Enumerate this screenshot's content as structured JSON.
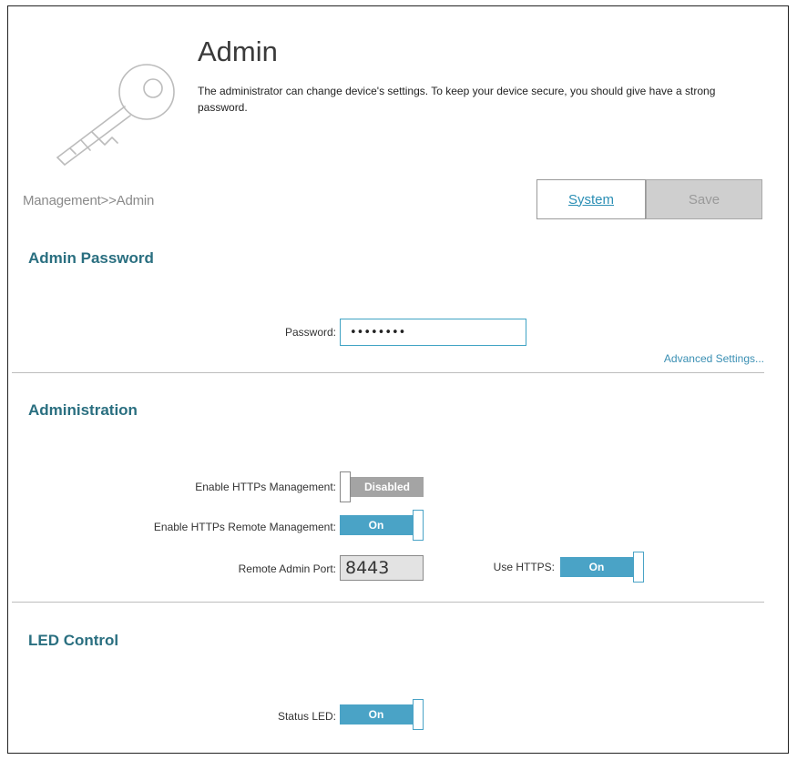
{
  "header": {
    "title": "Admin",
    "description": "The administrator can change device's settings. To keep your device secure, you should give have a strong password."
  },
  "breadcrumb": "Management>>Admin",
  "buttons": {
    "system_label": "System",
    "save_label": "Save"
  },
  "admin_password": {
    "section_title": "Admin Password",
    "password_label": "Password:",
    "password_value": "••••••••",
    "advanced_settings_link": "Advanced Settings..."
  },
  "administration": {
    "section_title": "Administration",
    "https_management_label": "Enable HTTPs Management:",
    "https_management_state": "Disabled",
    "https_remote_label": "Enable HTTPs Remote Management:",
    "https_remote_state": "On",
    "remote_port_label": "Remote Admin Port:",
    "remote_port_value": "8443",
    "use_https_label": "Use HTTPS:",
    "use_https_state": "On"
  },
  "led_control": {
    "section_title": "LED Control",
    "status_led_label": "Status LED:",
    "status_led_state": "On"
  },
  "colors": {
    "accent": "#4aa3c6",
    "section_title": "#2a6f80",
    "link": "#2c8fb5",
    "disabled": "#a4a4a4"
  },
  "icons": {
    "header_art": "key-icon"
  }
}
